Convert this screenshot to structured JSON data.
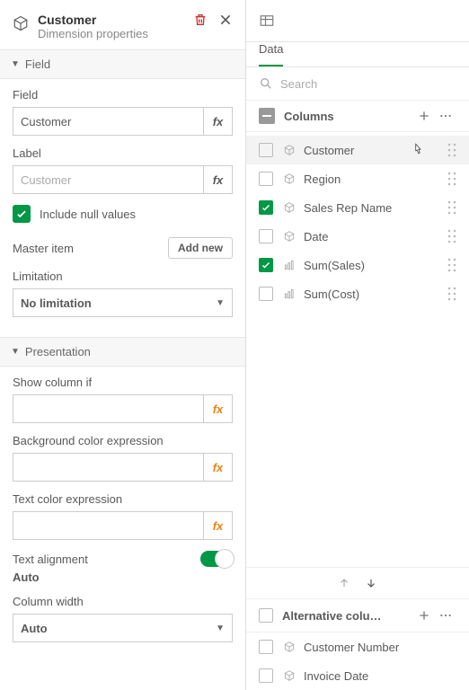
{
  "header": {
    "title": "Customer",
    "subtitle": "Dimension properties"
  },
  "sections": {
    "field_label": "Field",
    "presentation_label": "Presentation"
  },
  "field_section": {
    "field_label": "Field",
    "field_value": "Customer",
    "label_label": "Label",
    "label_placeholder": "Customer",
    "include_null_label": "Include null values",
    "include_null_checked": true,
    "master_item_label": "Master item",
    "add_new_label": "Add new",
    "limitation_label": "Limitation",
    "limitation_value": "No limitation"
  },
  "presentation_section": {
    "show_column_if_label": "Show column if",
    "show_column_if_value": "",
    "bg_expr_label": "Background color expression",
    "bg_expr_value": "",
    "text_expr_label": "Text color expression",
    "text_expr_value": "",
    "text_align_label": "Text alignment",
    "text_align_value": "Auto",
    "column_width_label": "Column width",
    "column_width_value": "Auto"
  },
  "right": {
    "tab_label": "Data",
    "search_placeholder": "Search",
    "columns_label": "Columns",
    "alt_columns_label": "Alternative colu…",
    "columns": [
      {
        "label": "Customer",
        "checked": false,
        "type": "dimension",
        "hover": true
      },
      {
        "label": "Region",
        "checked": false,
        "type": "dimension",
        "hover": false
      },
      {
        "label": "Sales Rep Name",
        "checked": true,
        "type": "dimension",
        "hover": false
      },
      {
        "label": "Date",
        "checked": false,
        "type": "dimension",
        "hover": false
      },
      {
        "label": "Sum(Sales)",
        "checked": true,
        "type": "measure",
        "hover": false
      },
      {
        "label": "Sum(Cost)",
        "checked": false,
        "type": "measure",
        "hover": false
      }
    ],
    "alt_columns": [
      {
        "label": "Customer Number",
        "checked": false,
        "type": "dimension"
      },
      {
        "label": "Invoice Date",
        "checked": false,
        "type": "dimension"
      }
    ]
  }
}
